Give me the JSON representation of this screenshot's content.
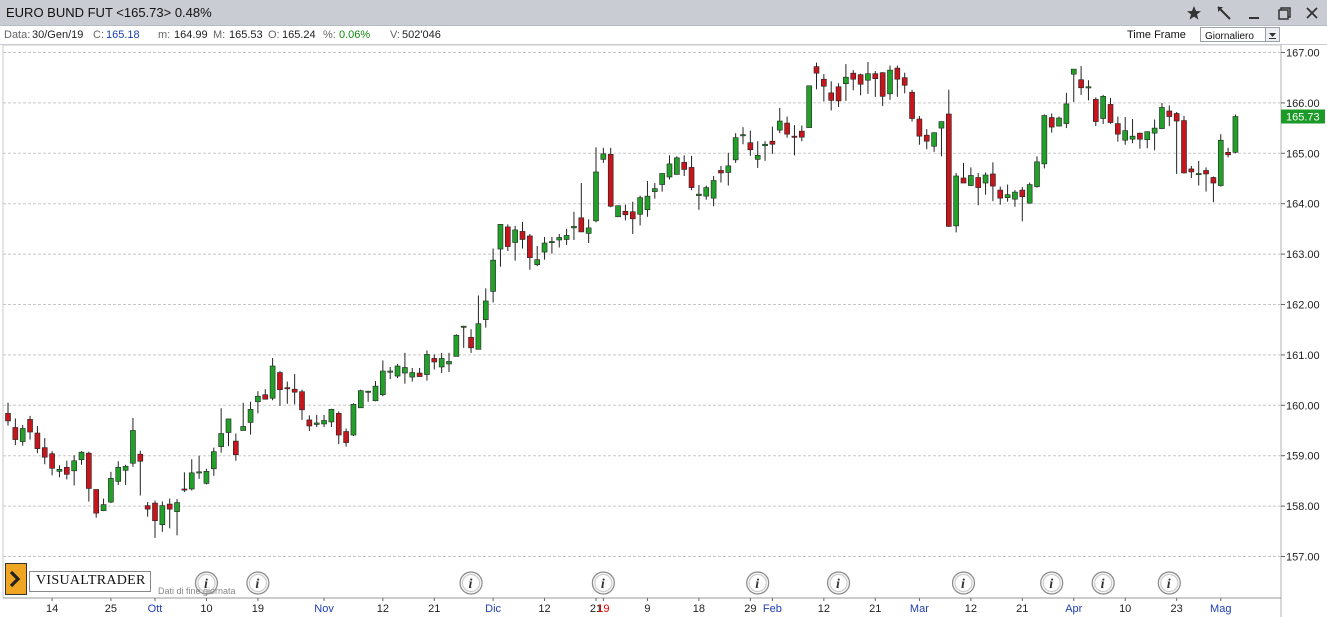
{
  "window": {
    "title": "EURO BUND FUT <165.73> 0.48%"
  },
  "infobar": {
    "data_label": "Data:",
    "data_value": "30/Gen/19",
    "c_label": "C:",
    "c_value": "165.18",
    "m_label": "m:",
    "m_value": "164.99",
    "M_label": "M:",
    "M_value": "165.53",
    "o_label": "O:",
    "o_value": "165.24",
    "pct_label": "%:",
    "pct_value": "0.06%",
    "v_label": "V:",
    "v_value": "502'046",
    "timeframe_label": "Time Frame",
    "timeframe_value": "Giornaliero"
  },
  "branding": {
    "logo_text": "VISUALTRADER",
    "subtitle": "Dati di fine giornata"
  },
  "colors": {
    "up": "#22a02a",
    "down": "#c4161c",
    "last_price_bg": "#1c9a28",
    "grid": "#c8c8c8"
  },
  "chart_data": {
    "type": "candlestick",
    "ylim": [
      156.6,
      167.2
    ],
    "y_ticks": [
      "157.00",
      "158.00",
      "159.00",
      "160.00",
      "161.00",
      "162.00",
      "163.00",
      "164.00",
      "165.00",
      "166.00",
      "167.00"
    ],
    "last_price": "165.73",
    "x_tick_labels": [
      {
        "label": "14",
        "kind": "day",
        "idx": 6
      },
      {
        "label": "25",
        "kind": "day",
        "idx": 14
      },
      {
        "label": "Ott",
        "kind": "month",
        "idx": 20
      },
      {
        "label": "10",
        "kind": "day",
        "idx": 27
      },
      {
        "label": "19",
        "kind": "day",
        "idx": 34
      },
      {
        "label": "Nov",
        "kind": "month",
        "idx": 43
      },
      {
        "label": "12",
        "kind": "day",
        "idx": 51
      },
      {
        "label": "21",
        "kind": "day",
        "idx": 58
      },
      {
        "label": "Dic",
        "kind": "month",
        "idx": 66
      },
      {
        "label": "12",
        "kind": "day",
        "idx": 73
      },
      {
        "label": "21",
        "kind": "day",
        "idx": 80
      },
      {
        "label": "19",
        "kind": "year",
        "idx": 81
      },
      {
        "label": "9",
        "kind": "day",
        "idx": 87
      },
      {
        "label": "18",
        "kind": "day",
        "idx": 94
      },
      {
        "label": "29",
        "kind": "day",
        "idx": 101
      },
      {
        "label": "Feb",
        "kind": "month",
        "idx": 104
      },
      {
        "label": "12",
        "kind": "day",
        "idx": 111
      },
      {
        "label": "21",
        "kind": "day",
        "idx": 118
      },
      {
        "label": "Mar",
        "kind": "month",
        "idx": 124
      },
      {
        "label": "12",
        "kind": "day",
        "idx": 131
      },
      {
        "label": "21",
        "kind": "day",
        "idx": 138
      },
      {
        "label": "Apr",
        "kind": "month",
        "idx": 145
      },
      {
        "label": "10",
        "kind": "day",
        "idx": 152
      },
      {
        "label": "23",
        "kind": "day",
        "idx": 159
      },
      {
        "label": "Mag",
        "kind": "month",
        "idx": 165
      }
    ],
    "info_markers_idx": [
      27,
      34,
      63,
      81,
      102,
      113,
      130,
      142,
      149,
      158
    ],
    "candles": [
      [
        159.84,
        160.05,
        159.6,
        159.69
      ],
      [
        159.56,
        159.74,
        159.21,
        159.32
      ],
      [
        159.28,
        159.61,
        159.2,
        159.54
      ],
      [
        159.72,
        159.79,
        159.32,
        159.47
      ],
      [
        159.45,
        159.59,
        159.05,
        159.14
      ],
      [
        159.16,
        159.35,
        158.83,
        158.97
      ],
      [
        159.04,
        159.09,
        158.61,
        158.75
      ],
      [
        158.69,
        158.81,
        158.57,
        158.73
      ],
      [
        158.77,
        158.9,
        158.53,
        158.63
      ],
      [
        158.7,
        159.01,
        158.41,
        158.9
      ],
      [
        158.92,
        159.09,
        158.82,
        159.07
      ],
      [
        159.05,
        159.08,
        158.09,
        158.35
      ],
      [
        158.33,
        158.33,
        157.77,
        157.86
      ],
      [
        157.91,
        158.15,
        157.9,
        158.03
      ],
      [
        158.08,
        158.68,
        158.06,
        158.55
      ],
      [
        158.49,
        158.89,
        158.42,
        158.77
      ],
      [
        158.71,
        158.82,
        158.42,
        158.79
      ],
      [
        158.85,
        159.75,
        158.78,
        159.5
      ],
      [
        159.03,
        159.1,
        158.21,
        158.89
      ],
      [
        158.01,
        158.08,
        157.79,
        157.94
      ],
      [
        158.06,
        158.11,
        157.37,
        157.71
      ],
      [
        157.63,
        158.09,
        157.49,
        158.01
      ],
      [
        158.04,
        158.15,
        157.56,
        157.94
      ],
      [
        157.89,
        158.14,
        157.42,
        158.07
      ],
      [
        158.34,
        158.67,
        158.28,
        158.33
      ],
      [
        158.34,
        158.93,
        158.31,
        158.66
      ],
      [
        158.68,
        159.0,
        158.54,
        158.68
      ],
      [
        158.45,
        158.74,
        158.43,
        158.69
      ],
      [
        158.74,
        159.16,
        158.6,
        159.08
      ],
      [
        159.18,
        159.94,
        159.06,
        159.44
      ],
      [
        159.46,
        159.65,
        159.19,
        159.73
      ],
      [
        159.29,
        159.44,
        158.9,
        159.02
      ],
      [
        159.5,
        160.05,
        159.5,
        159.58
      ],
      [
        159.66,
        160.07,
        159.42,
        159.92
      ],
      [
        160.07,
        160.28,
        159.84,
        160.18
      ],
      [
        160.21,
        160.32,
        160.17,
        160.12
      ],
      [
        160.14,
        160.94,
        160.1,
        160.78
      ],
      [
        160.65,
        160.68,
        159.99,
        160.31
      ],
      [
        160.35,
        160.47,
        160.03,
        160.34
      ],
      [
        160.32,
        160.62,
        160.02,
        160.26
      ],
      [
        160.27,
        160.31,
        159.71,
        159.91
      ],
      [
        159.71,
        159.8,
        159.49,
        159.59
      ],
      [
        159.62,
        159.81,
        159.57,
        159.65
      ],
      [
        159.63,
        159.81,
        159.57,
        159.7
      ],
      [
        159.67,
        159.93,
        159.57,
        159.92
      ],
      [
        159.84,
        159.88,
        159.23,
        159.41
      ],
      [
        159.48,
        159.54,
        159.18,
        159.26
      ],
      [
        159.41,
        160.04,
        159.39,
        160.02
      ],
      [
        159.95,
        160.31,
        159.96,
        160.29
      ],
      [
        160.28,
        160.29,
        160.07,
        160.28
      ],
      [
        160.09,
        160.48,
        160.08,
        160.38
      ],
      [
        160.21,
        160.89,
        160.18,
        160.68
      ],
      [
        160.66,
        160.76,
        160.52,
        160.68
      ],
      [
        160.58,
        160.82,
        160.54,
        160.78
      ],
      [
        160.64,
        161.04,
        160.43,
        160.75
      ],
      [
        160.56,
        160.74,
        160.47,
        160.65
      ],
      [
        160.64,
        160.74,
        160.59,
        160.57
      ],
      [
        160.61,
        161.09,
        160.49,
        161.01
      ],
      [
        160.93,
        161.01,
        160.71,
        160.86
      ],
      [
        160.76,
        161.04,
        160.64,
        160.93
      ],
      [
        160.82,
        161.04,
        160.66,
        160.87
      ],
      [
        160.97,
        161.41,
        160.99,
        161.39
      ],
      [
        161.57,
        161.58,
        161.14,
        161.57
      ],
      [
        161.35,
        161.51,
        161.04,
        161.14
      ],
      [
        161.11,
        162.18,
        161.15,
        161.62
      ],
      [
        161.7,
        162.32,
        161.54,
        162.07
      ],
      [
        162.26,
        163.11,
        162.04,
        162.88
      ],
      [
        163.1,
        163.46,
        162.75,
        163.59
      ],
      [
        163.54,
        163.59,
        163.06,
        163.15
      ],
      [
        163.23,
        163.56,
        162.87,
        163.48
      ],
      [
        163.45,
        163.64,
        163.11,
        163.29
      ],
      [
        163.36,
        163.4,
        162.69,
        162.93
      ],
      [
        162.79,
        163.16,
        162.76,
        162.89
      ],
      [
        163.04,
        163.34,
        162.89,
        163.22
      ],
      [
        163.25,
        163.34,
        163.01,
        163.25
      ],
      [
        163.28,
        163.4,
        163.13,
        163.33
      ],
      [
        163.29,
        163.5,
        163.18,
        163.37
      ],
      [
        163.52,
        163.84,
        163.28,
        163.55
      ],
      [
        163.72,
        164.41,
        163.44,
        163.44
      ],
      [
        163.41,
        163.69,
        163.22,
        163.52
      ],
      [
        163.66,
        165.12,
        163.63,
        164.63
      ],
      [
        164.88,
        165.11,
        164.81,
        164.99
      ],
      [
        164.98,
        165.11,
        163.93,
        163.95
      ],
      [
        163.74,
        163.95,
        163.75,
        163.96
      ],
      [
        163.85,
        163.98,
        163.67,
        163.78
      ],
      [
        163.84,
        164.04,
        163.4,
        163.7
      ],
      [
        163.79,
        164.16,
        163.57,
        164.12
      ],
      [
        163.88,
        164.45,
        163.74,
        164.15
      ],
      [
        164.24,
        164.41,
        164.1,
        164.3
      ],
      [
        164.38,
        164.59,
        164.24,
        164.6
      ],
      [
        164.53,
        164.96,
        164.48,
        164.79
      ],
      [
        164.58,
        164.94,
        164.59,
        164.91
      ],
      [
        164.82,
        164.96,
        164.55,
        164.68
      ],
      [
        164.72,
        164.95,
        164.27,
        164.32
      ],
      [
        164.16,
        164.37,
        163.88,
        164.19
      ],
      [
        164.15,
        164.36,
        164.08,
        164.32
      ],
      [
        164.11,
        164.55,
        163.95,
        164.46
      ],
      [
        164.66,
        164.75,
        164.42,
        164.61
      ],
      [
        164.62,
        165.01,
        164.36,
        164.75
      ],
      [
        164.87,
        165.4,
        164.81,
        165.31
      ],
      [
        165.35,
        165.52,
        165.18,
        165.37
      ],
      [
        165.21,
        165.45,
        164.95,
        165.07
      ],
      [
        164.88,
        165.24,
        164.71,
        164.96
      ],
      [
        165.15,
        165.24,
        164.85,
        165.18
      ],
      [
        165.24,
        165.53,
        164.99,
        165.18
      ],
      [
        165.46,
        165.9,
        165.4,
        165.64
      ],
      [
        165.6,
        165.73,
        165.31,
        165.38
      ],
      [
        165.34,
        165.56,
        164.96,
        165.33
      ],
      [
        165.44,
        165.55,
        165.24,
        165.32
      ],
      [
        165.51,
        166.34,
        165.56,
        166.34
      ],
      [
        166.72,
        166.8,
        166.27,
        166.59
      ],
      [
        166.47,
        166.57,
        166.03,
        166.33
      ],
      [
        166.2,
        166.43,
        165.85,
        166.05
      ],
      [
        166.32,
        166.39,
        165.92,
        166.04
      ],
      [
        166.38,
        166.77,
        166.04,
        166.51
      ],
      [
        166.59,
        166.65,
        166.25,
        166.47
      ],
      [
        166.56,
        166.58,
        166.15,
        166.37
      ],
      [
        166.45,
        166.81,
        166.18,
        166.58
      ],
      [
        166.58,
        166.63,
        166.12,
        166.48
      ],
      [
        166.6,
        166.61,
        165.94,
        166.13
      ],
      [
        166.18,
        166.74,
        166.06,
        166.65
      ],
      [
        166.69,
        166.74,
        166.12,
        166.47
      ],
      [
        166.5,
        166.6,
        166.19,
        166.35
      ],
      [
        166.21,
        166.26,
        165.63,
        165.69
      ],
      [
        165.68,
        165.74,
        165.17,
        165.34
      ],
      [
        165.36,
        165.48,
        165.08,
        165.24
      ],
      [
        165.14,
        165.41,
        165.03,
        165.41
      ],
      [
        165.5,
        165.57,
        164.94,
        165.63
      ],
      [
        165.78,
        166.26,
        163.54,
        163.55
      ],
      [
        163.56,
        164.61,
        163.43,
        164.55
      ],
      [
        164.51,
        164.81,
        164.49,
        164.41
      ],
      [
        164.36,
        164.72,
        164.35,
        164.56
      ],
      [
        164.52,
        164.61,
        163.97,
        164.32
      ],
      [
        164.41,
        164.62,
        164.18,
        164.57
      ],
      [
        164.59,
        164.82,
        164.05,
        164.35
      ],
      [
        164.27,
        164.34,
        163.98,
        164.11
      ],
      [
        164.12,
        164.38,
        164.04,
        164.18
      ],
      [
        164.09,
        164.27,
        163.94,
        164.23
      ],
      [
        164.27,
        164.33,
        163.65,
        164.14
      ],
      [
        164.01,
        164.42,
        164.05,
        164.38
      ],
      [
        164.34,
        164.94,
        164.32,
        164.83
      ],
      [
        164.79,
        165.77,
        164.7,
        165.75
      ],
      [
        165.71,
        165.79,
        165.41,
        165.52
      ],
      [
        165.54,
        165.73,
        165.54,
        165.7
      ],
      [
        165.59,
        166.2,
        165.5,
        165.98
      ],
      [
        166.57,
        166.64,
        166.02,
        166.67
      ],
      [
        166.46,
        166.73,
        166.16,
        166.3
      ],
      [
        166.31,
        166.45,
        166.05,
        166.32
      ],
      [
        166.07,
        166.11,
        165.54,
        165.63
      ],
      [
        165.69,
        166.16,
        165.58,
        166.13
      ],
      [
        165.97,
        166.1,
        165.59,
        165.61
      ],
      [
        165.59,
        165.73,
        165.23,
        165.38
      ],
      [
        165.26,
        165.72,
        165.17,
        165.45
      ],
      [
        165.28,
        165.68,
        165.2,
        165.34
      ],
      [
        165.4,
        165.41,
        165.09,
        165.28
      ],
      [
        165.27,
        165.38,
        165.1,
        165.43
      ],
      [
        165.4,
        165.67,
        165.06,
        165.5
      ],
      [
        165.49,
        166.0,
        165.48,
        165.91
      ],
      [
        165.84,
        165.95,
        165.54,
        165.73
      ],
      [
        165.79,
        165.82,
        164.59,
        165.64
      ],
      [
        165.65,
        165.74,
        164.6,
        164.61
      ],
      [
        164.69,
        164.75,
        164.51,
        164.63
      ],
      [
        164.6,
        164.85,
        164.36,
        164.6
      ],
      [
        164.66,
        164.72,
        164.24,
        164.59
      ],
      [
        164.52,
        164.54,
        164.03,
        164.41
      ],
      [
        164.36,
        165.38,
        164.34,
        165.26
      ],
      [
        165.02,
        165.11,
        164.92,
        164.97
      ],
      [
        165.02,
        165.77,
        165.0,
        165.73
      ]
    ]
  }
}
